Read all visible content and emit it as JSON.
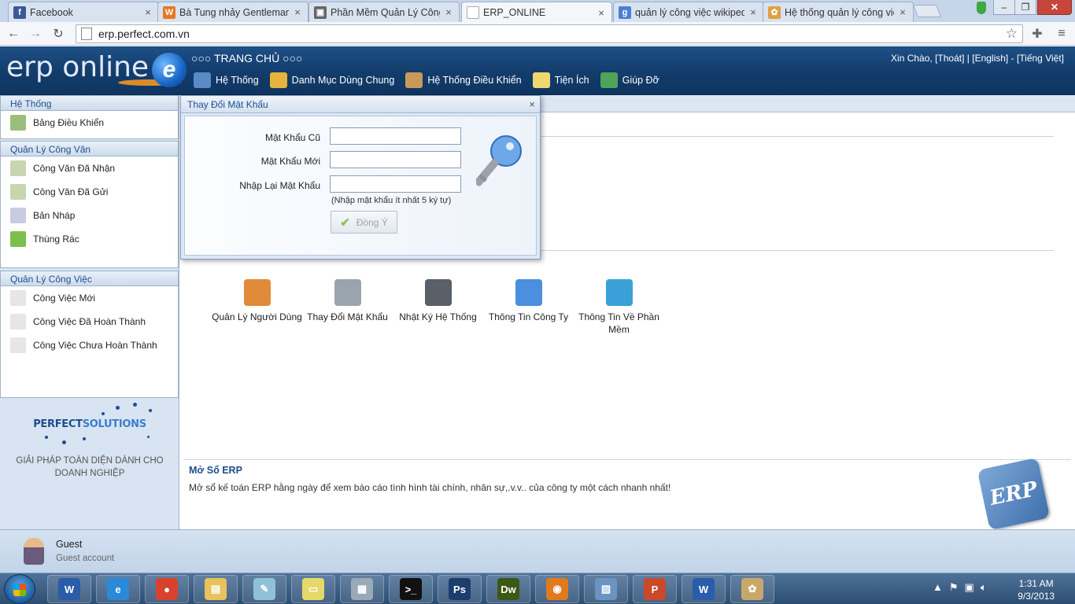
{
  "browser": {
    "tabs": [
      {
        "label": "Facebook",
        "favicon": "facebook-icon",
        "color": "#3b5998",
        "glyph": "f"
      },
      {
        "label": "Bà Tung nhảy Gentleman",
        "favicon": "w-site-icon",
        "color": "#e87722",
        "glyph": "W"
      },
      {
        "label": "Phần Mềm Quản Lý Công",
        "favicon": "page-icon",
        "color": "#666666",
        "glyph": "▣"
      },
      {
        "label": "ERP_ONLINE",
        "favicon": "blank-page-icon",
        "color": "#ffffff",
        "glyph": ""
      },
      {
        "label": "quản lý công việc wikipedi",
        "favicon": "google-icon",
        "color": "#4a7fd6",
        "glyph": "g"
      },
      {
        "label": "Hệ thống quản lý công việ",
        "favicon": "site-icon",
        "color": "#e0a040",
        "glyph": "✿"
      }
    ],
    "active_tab": 3,
    "url": "erp.perfect.com.vn"
  },
  "app": {
    "logo_text": "erp online",
    "logo_letter": "e",
    "home_label": "○○○ TRANG CHỦ ○○○",
    "user_links": {
      "greeting": "Xin Chào,",
      "logout": "[Thoát]",
      "english": "[English]",
      "vietnamese": "[Tiếng Việt]"
    },
    "menu": [
      {
        "label": "Hệ Thống",
        "icon": "computer-icon",
        "color": "#5b8bc6"
      },
      {
        "label": "Danh Mục Dùng Chung",
        "icon": "folder-icon",
        "color": "#e6b43a"
      },
      {
        "label": "Hệ Thống Điều Khiển",
        "icon": "users-icon",
        "color": "#c89a5a"
      },
      {
        "label": "Tiện Ích",
        "icon": "edit-icon",
        "color": "#f0d870"
      },
      {
        "label": "Giúp Đỡ",
        "icon": "help-icon",
        "color": "#4fa35a"
      }
    ]
  },
  "sidebar": {
    "sections": [
      {
        "title": "Hệ Thống",
        "items": [
          {
            "label": "Bảng Điều Khiển",
            "icon": "dashboard-mail-icon",
            "color": "#9bbf7a"
          }
        ]
      },
      {
        "title": "Quản Lý Công Văn",
        "items": [
          {
            "label": "Công Văn Đã Nhận",
            "icon": "mail-received-icon",
            "color": "#c8d6b0"
          },
          {
            "label": "Công Văn Đã Gửi",
            "icon": "mail-sent-icon",
            "color": "#c8d6b0"
          },
          {
            "label": "Bản Nháp",
            "icon": "draft-icon",
            "color": "#c9cbe0"
          },
          {
            "label": "Thùng Rác",
            "icon": "recycle-bin-icon",
            "color": "#7cbf4a"
          }
        ]
      },
      {
        "title": "Quản Lý Công Việc",
        "items": [
          {
            "label": "Công Việc Mới",
            "icon": "new-task-icon",
            "color": "#e6e6e6"
          },
          {
            "label": "Công Việc Đã Hoàn Thành",
            "icon": "completed-task-icon",
            "color": "#e6e6e6"
          },
          {
            "label": "Công Việc Chưa Hoàn Thành",
            "icon": "warning-task-icon",
            "color": "#e6e6e6"
          }
        ]
      }
    ],
    "brand_name_left": "PERFECT",
    "brand_name_right": "SOLUTIONS",
    "brand_tagline": "GIẢI PHÁP TOÀN DIỆN DÀNH CHO DOANH NGHIỆP"
  },
  "main": {
    "shortcuts": [
      {
        "label": "Quản Lý Người Dùng",
        "icon": "user-management-icon",
        "color": "#e08a3a"
      },
      {
        "label": "Thay Đổi Mật Khẩu",
        "icon": "wrench-icon",
        "color": "#9aa4ae"
      },
      {
        "label": "Nhật Ký Hệ Thống",
        "icon": "monitor-icon",
        "color": "#5a6068"
      },
      {
        "label": "Thông Tin Công Ty",
        "icon": "info-icon",
        "color": "#4a8fe0"
      },
      {
        "label": "Thông Tin Về Phần Mềm",
        "icon": "broadcast-info-icon",
        "color": "#3aa0d8"
      }
    ],
    "news_title": "Mở Sổ ERP",
    "news_text": "Mở sổ kế toán ERP hằng ngày để xem báo cáo tình hình tài chính, nhân sự,.v.v.. của công ty một cách nhanh nhất!",
    "badge_text": "ERP"
  },
  "dialog": {
    "title": "Thay Đổi Mật Khẩu",
    "close": "×",
    "fields": [
      {
        "label": "Mật Khẩu Cũ",
        "value": ""
      },
      {
        "label": "Mật Khẩu Mới",
        "value": ""
      },
      {
        "label": "Nhập Lại Mật Khẩu",
        "value": ""
      }
    ],
    "hint": "(Nhập mật khẩu ít nhất 5 ký tự)",
    "ok_label": "Đồng Ý",
    "ok_enabled": false
  },
  "status": {
    "user_name": "Guest",
    "user_sub": "Guest account"
  },
  "taskbar": {
    "apps": [
      {
        "name": "word-icon",
        "color": "#2b5caa",
        "glyph": "W"
      },
      {
        "name": "internet-explorer-icon",
        "color": "#2a8ad8",
        "glyph": "e"
      },
      {
        "name": "chrome-icon",
        "color": "#d9412f",
        "glyph": "●"
      },
      {
        "name": "file-explorer-icon",
        "color": "#e8c25a",
        "glyph": "▤"
      },
      {
        "name": "notepad-icon",
        "color": "#8fc1d8",
        "glyph": "✎"
      },
      {
        "name": "sticky-notes-icon",
        "color": "#e6d86a",
        "glyph": "▭"
      },
      {
        "name": "calculator-icon",
        "color": "#9aa9b8",
        "glyph": "▦"
      },
      {
        "name": "command-prompt-icon",
        "color": "#111111",
        "glyph": ">_"
      },
      {
        "name": "photoshop-icon",
        "color": "#1d3d6e",
        "glyph": "Ps"
      },
      {
        "name": "dreamweaver-icon",
        "color": "#3a5a14",
        "glyph": "Dw"
      },
      {
        "name": "firefox-icon",
        "color": "#e07a1f",
        "glyph": "◉"
      },
      {
        "name": "image-viewer-icon",
        "color": "#6a95c2",
        "glyph": "▨"
      },
      {
        "name": "powerpoint-icon",
        "color": "#c84a2a",
        "glyph": "P"
      },
      {
        "name": "word-doc-icon",
        "color": "#2b5caa",
        "glyph": "W"
      },
      {
        "name": "paint-icon",
        "color": "#c8a86a",
        "glyph": "✿"
      }
    ],
    "time": "1:31 AM",
    "date": "9/3/2013"
  }
}
